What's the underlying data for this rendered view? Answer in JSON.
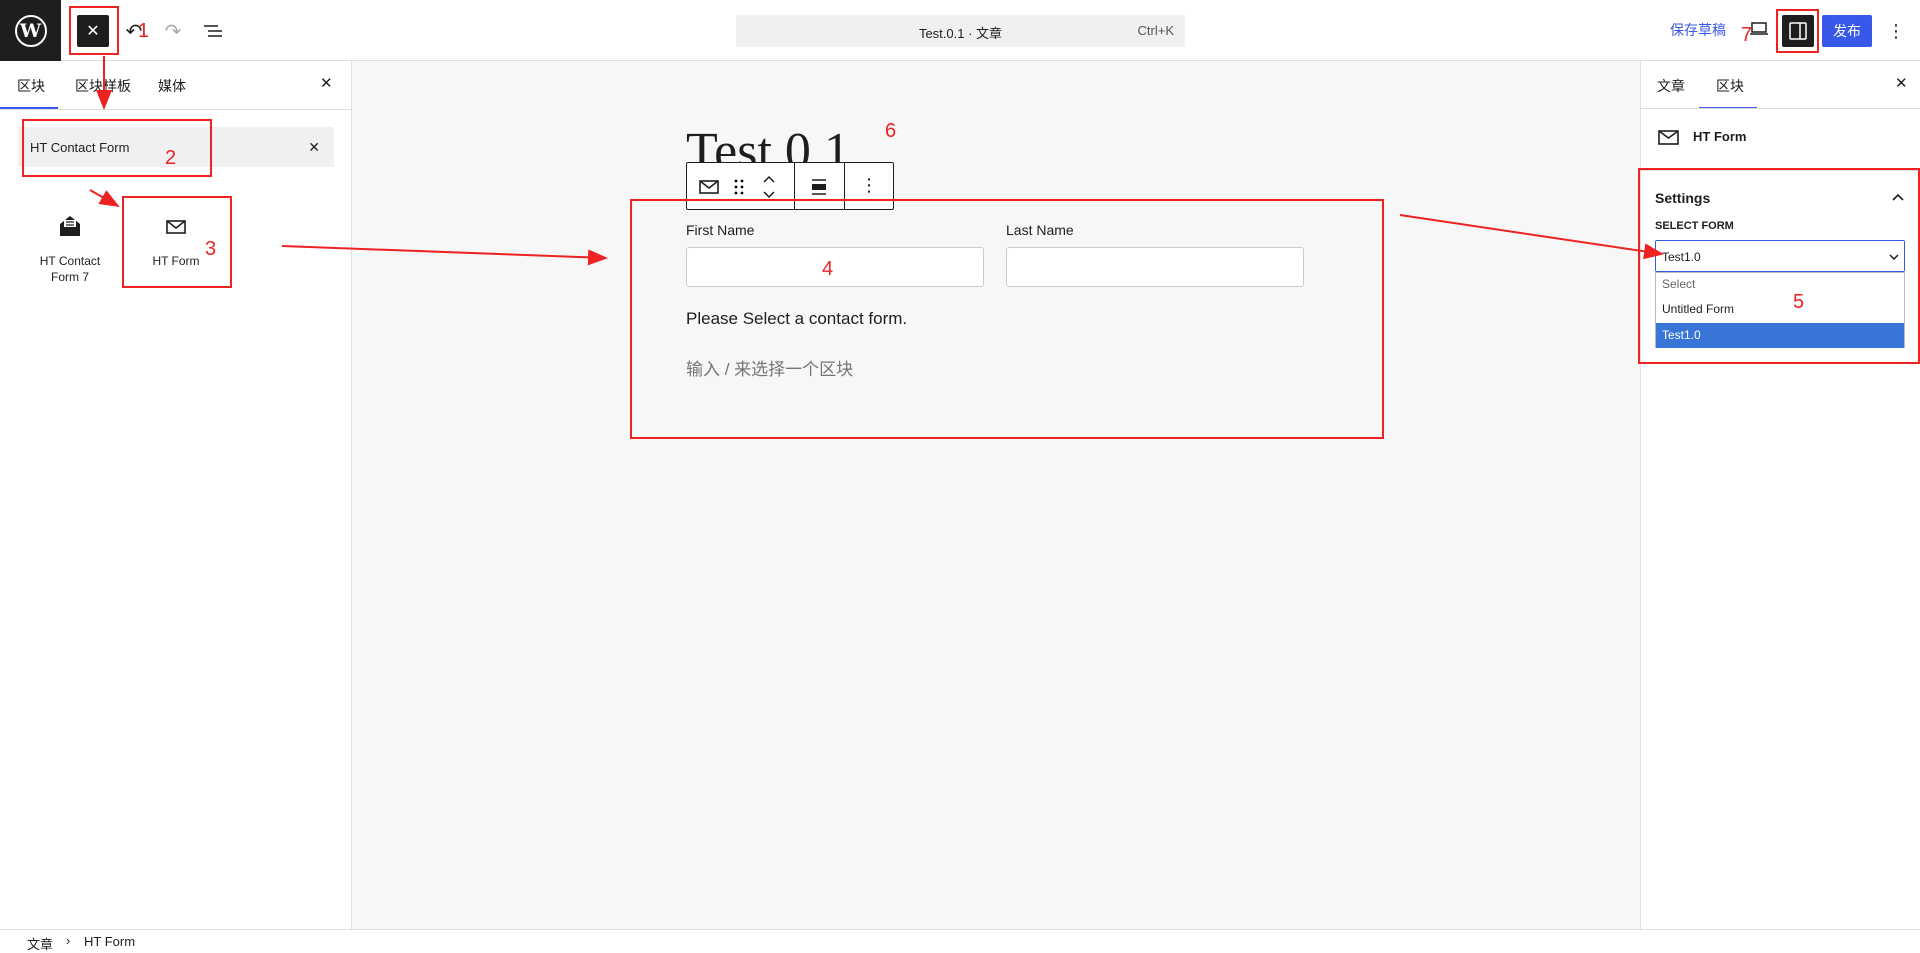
{
  "topbar": {
    "undo_icon": "↶",
    "redo_icon": "↷",
    "close_icon": "✕",
    "document_title": "Test.0.1 · 文章",
    "shortcut": "Ctrl+K",
    "save_draft": "保存草稿",
    "publish": "发布",
    "options_icon": "⋮"
  },
  "left_panel": {
    "tabs": [
      "区块",
      "区块样板",
      "媒体"
    ],
    "close_icon": "✕",
    "search_value": "HT Contact Form",
    "search_clear_icon": "✕",
    "results": [
      {
        "label": "HT Contact Form 7",
        "icon": "contact-form-icon"
      },
      {
        "label": "HT Form",
        "icon": "envelope-icon"
      }
    ]
  },
  "canvas": {
    "post_title": "Test.0.1",
    "first_name_label": "First Name",
    "last_name_label": "Last Name",
    "form_message": "Please Select a contact form.",
    "append_hint": "输入 / 来选择一个区块"
  },
  "right_panel": {
    "tabs": [
      "文章",
      "区块"
    ],
    "close_icon": "✕",
    "block_name": "HT Form",
    "settings_title": "Settings",
    "select_label": "SELECT FORM",
    "selected_value": "Test1.0",
    "options": [
      "Select",
      "Untitled Form",
      "Test1.0"
    ]
  },
  "footer": {
    "breadcrumb": [
      "文章",
      "HT Form"
    ],
    "separator": "›"
  },
  "annotations": {
    "numbers": [
      "1",
      "2",
      "3",
      "4",
      "5",
      "6",
      "7"
    ],
    "color": "#ee2222"
  },
  "colors": {
    "accent": "#3858e9",
    "dark": "#1e1e1e"
  }
}
